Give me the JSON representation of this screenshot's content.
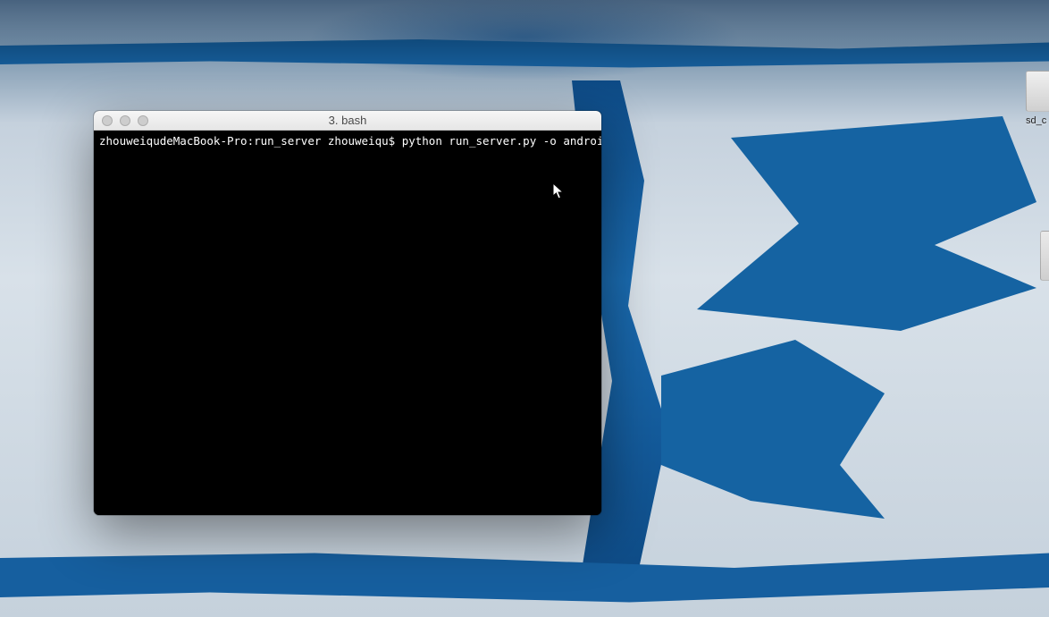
{
  "window": {
    "title": "3. bash"
  },
  "terminal": {
    "prompt_host": "zhouweiqudeMacBook-Pro",
    "prompt_path": "run_server",
    "prompt_user": "zhouweiqu",
    "prompt_symbol": "$",
    "command": "python run_server.py -o android"
  },
  "desktop": {
    "icon1_label": "sd_c"
  }
}
